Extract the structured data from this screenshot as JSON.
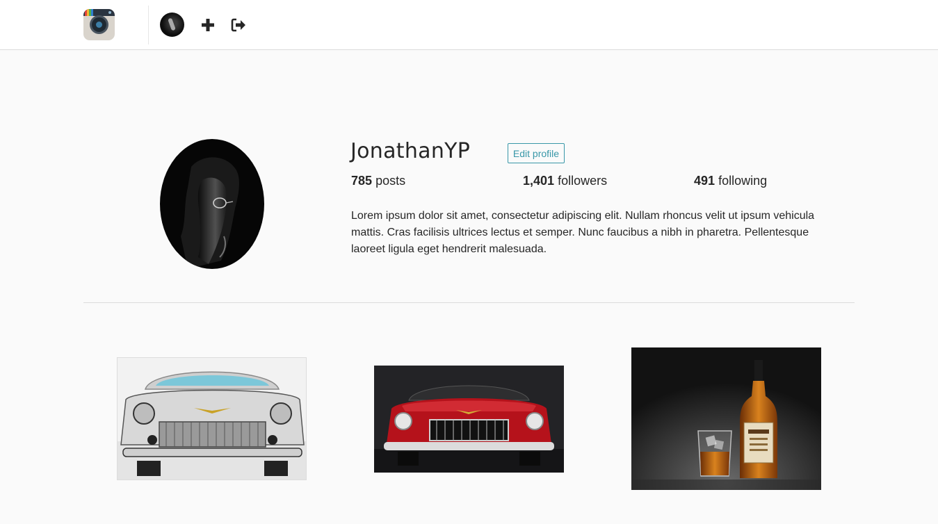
{
  "nav": {
    "logo_icon": "camera-app-logo-icon",
    "avatar_icon": "user-avatar-icon",
    "new_post_icon": "plus-icon",
    "logout_icon": "sign-out-icon"
  },
  "profile": {
    "username": "JonathanYP",
    "edit_label": "Edit profile",
    "stats": {
      "posts_count": "785",
      "posts_label": "posts",
      "followers_count": "1,401",
      "followers_label": "followers",
      "following_count": "491",
      "following_label": "following"
    },
    "bio": "Lorem ipsum dolor sit amet, consectetur adipiscing elit. Nullam rhoncus velit ut ipsum vehicula mattis. Cras facilisis ultrices lectus et semper. Nunc faucibus a nibh in pharetra. Pellentesque laoreet ligula eget hendrerit malesuada."
  },
  "posts": [
    {
      "subject": "white-classic-car-photo"
    },
    {
      "subject": "red-classic-car-photo"
    },
    {
      "subject": "whisky-bottle-and-glass-photo"
    }
  ],
  "colors": {
    "accent": "#3897a8",
    "background": "#fafafa",
    "text": "#262626",
    "divider": "#dbdbdb"
  }
}
